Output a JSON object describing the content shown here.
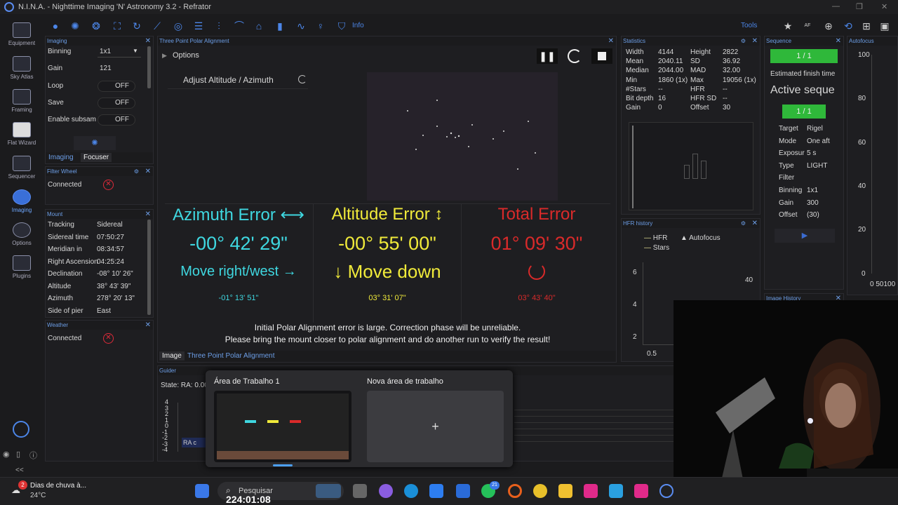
{
  "window": {
    "title": "N.I.N.A. - Nighttime Imaging 'N' Astronomy 3.2  -  Refrator",
    "controls": [
      "—",
      "❐",
      "✕"
    ]
  },
  "nav": [
    {
      "label": "Equipment"
    },
    {
      "label": "Sky Atlas"
    },
    {
      "label": "Framing"
    },
    {
      "label": "Flat Wizard"
    },
    {
      "label": "Sequencer"
    },
    {
      "label": "Imaging"
    },
    {
      "label": "Options"
    },
    {
      "label": "Plugins"
    }
  ],
  "toolbar": {
    "info": "Info",
    "tools": "Tools",
    "af_label": "AF"
  },
  "imaging": {
    "header": "Imaging",
    "bin_label": "Binning",
    "bin_value": "1x1",
    "gain_label": "Gain",
    "gain_value": "121",
    "loop_label": "Loop",
    "loop_value": "OFF",
    "save_label": "Save",
    "save_value": "OFF",
    "subsam_label": "Enable subsam",
    "subsam_value": "OFF",
    "tab_imaging": "Imaging",
    "tab_focuser": "Focuser"
  },
  "filterwheel": {
    "header": "Filter Wheel",
    "status": "Connected"
  },
  "mount": {
    "header": "Mount",
    "rows": [
      {
        "k": "Tracking",
        "v": "Sidereal"
      },
      {
        "k": "Sidereal time",
        "v": "07:50:27"
      },
      {
        "k": "Meridian in",
        "v": "08:34:57"
      },
      {
        "k": "Right Ascension",
        "v": "04:25:24"
      },
      {
        "k": "Declination",
        "v": "-08° 10' 26\""
      },
      {
        "k": "Altitude",
        "v": "38° 43' 39\""
      },
      {
        "k": "Azimuth",
        "v": "278° 20' 13\""
      },
      {
        "k": "Side of pier",
        "v": "East"
      }
    ]
  },
  "weather": {
    "header": "Weather",
    "status": "Connected"
  },
  "tppa": {
    "header": "Three Point Polar Alignment",
    "options": "Options",
    "step": "Adjust Altitude / Azimuth",
    "az": {
      "title": "Azimuth Error ⟷",
      "value": "-00° 42' 29\"",
      "move": "Move right/west →",
      "sub": "-01° 13' 51\""
    },
    "alt": {
      "title": "Altitude Error ↕",
      "value": "-00° 55' 00\"",
      "move": "↓ Move down",
      "sub": "03° 31' 07\""
    },
    "total": {
      "title": "Total Error",
      "value": "01° 09' 30\"",
      "sub": "03° 43' 40\""
    },
    "msg1": "Initial Polar Alignment error is large. Correction phase will be unreliable.",
    "msg2": "Please bring the mount closer to polar alignment and do another run to verify the result!",
    "tab_image": "Image",
    "tab_tppa": "Three Point Polar Alignment"
  },
  "statistics": {
    "header": "Statistics",
    "rows": [
      [
        "Width",
        "4144",
        "Height",
        "2822"
      ],
      [
        "Mean",
        "2040.11",
        "SD",
        "36.92"
      ],
      [
        "Median",
        "2044.00",
        "MAD",
        "32.00"
      ],
      [
        "Min",
        "1860 (1x)",
        "Max",
        "19056 (1x)"
      ],
      [
        "#Stars",
        "--",
        "HFR",
        "--"
      ],
      [
        "Bit depth",
        "16",
        "HFR SD",
        "--"
      ],
      [
        "Gain",
        "0",
        "Offset",
        "30"
      ]
    ]
  },
  "hfr": {
    "header": "HFR history",
    "legend_hfr": "HFR",
    "legend_af": "Autofocus",
    "legend_stars": "Stars",
    "y": [
      "6",
      "4",
      "2"
    ],
    "y2": "40",
    "x": "0.5"
  },
  "sequence": {
    "header": "Sequence",
    "progress": "1 / 1",
    "progress_fraction": 1.0,
    "finish": "Estimated finish time",
    "active": "Active seque",
    "sub_progress": "1 / 1",
    "rows": [
      {
        "k": "Target",
        "v": "Rigel"
      },
      {
        "k": "Mode",
        "v": "One aft"
      },
      {
        "k": "Exposur",
        "v": "5 s"
      },
      {
        "k": "Type",
        "v": "LIGHT"
      },
      {
        "k": "Filter",
        "v": ""
      },
      {
        "k": "Binning",
        "v": "1x1"
      },
      {
        "k": "Gain",
        "v": "300"
      },
      {
        "k": "Offset",
        "v": "(30)"
      }
    ]
  },
  "autofocus": {
    "header": "Autofocus",
    "y": [
      "100",
      "80",
      "60",
      "40",
      "20",
      "0"
    ],
    "x": "0 50100"
  },
  "imagehistory": {
    "header": "Image History"
  },
  "guider": {
    "header": "Guider",
    "state": "State:  RA: 0.00",
    "y": [
      "4",
      "3",
      "2",
      "1",
      "0",
      "-1",
      "-2",
      "-3",
      "-4"
    ],
    "ra": "RA c"
  },
  "taskview": {
    "ws1": "Área de Trabalho 1",
    "ws2": "Nova área de trabalho",
    "plus": "+"
  },
  "taskbar": {
    "weather": "Dias de chuva à...",
    "temp": "24°C",
    "badge": "2",
    "search": "Pesquisar",
    "clock": "224:01:08",
    "wa_badge": "21",
    "collapse": "<<"
  },
  "colors": {
    "accent": "#4c86e8",
    "green": "#2fb83a",
    "cyan": "#3fd7e0",
    "yellow": "#f0ea3a",
    "red": "#d92a2a"
  }
}
